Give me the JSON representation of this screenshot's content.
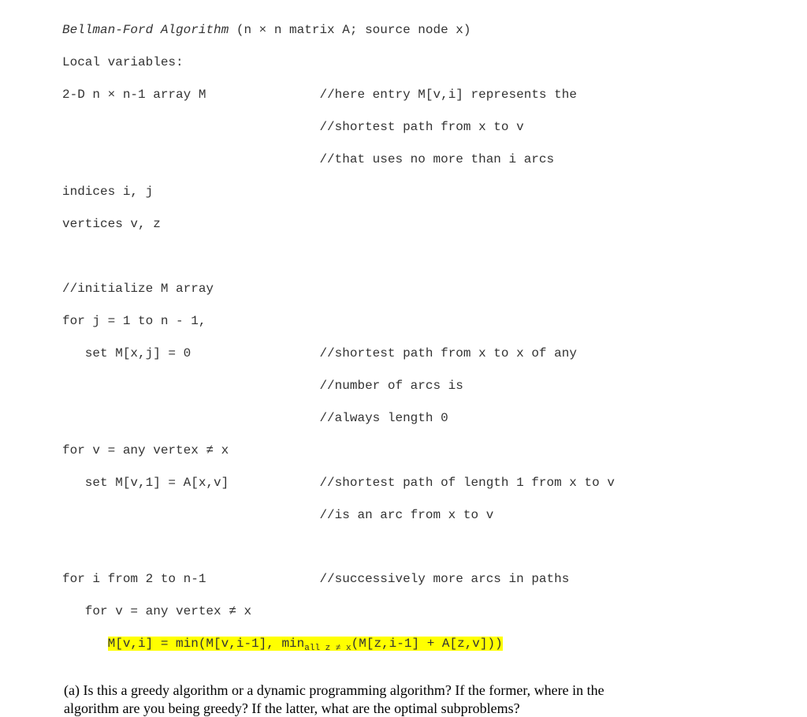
{
  "lines": {
    "title_italic": "Bellman-Ford Algorithm",
    "title_rest": " (n × n matrix A; source node x)",
    "local_vars": "Local variables:",
    "arr_decl_left": "2-D n × n-1 array M",
    "arr_decl_gap": "               ",
    "arr_comment1": "//here entry M[v,i] represents the",
    "arr_comment2_pad": "                                  ",
    "arr_comment2": "//shortest path from x to v",
    "arr_comment3_pad": "                                  ",
    "arr_comment3": "//that uses no more than i arcs",
    "indices": "indices i, j",
    "vertices": "vertices v, z",
    "init_comment": "//initialize M array",
    "for_j": "for j = 1 to n - 1,",
    "set_mxj": "   set M[x,j] = 0",
    "set_mxj_gap": "                 ",
    "mxj_comment1": "//shortest path from x to x of any",
    "mxj_comment2_pad": "                                  ",
    "mxj_comment2": "//number of arcs is",
    "mxj_comment3_pad": "                                  ",
    "mxj_comment3": "//always length 0",
    "for_v1": "for v = any vertex ≠ x",
    "set_mv1": "   set M[v,1] = A[x,v]",
    "set_mv1_gap": "            ",
    "mv1_comment1": "//shortest path of length 1 from x to v",
    "mv1_comment2_pad": "                                  ",
    "mv1_comment2": "//is an arc from x to v",
    "for_i": "for i from 2 to n-1",
    "for_i_gap": "               ",
    "for_i_comment": "//successively more arcs in paths",
    "for_v2": "   for v = any vertex ≠ x",
    "rec_pad": "      ",
    "rec_part1": "M[v,i] = min(M[v,i-1], min",
    "rec_sub": "all z ≠ x",
    "rec_part2": "(M[z,i-1] + A[z,v]))"
  },
  "question": {
    "label": "(a)",
    "text1": "  Is this a greedy algorithm or a dynamic programming algorithm?  If the former, where in the",
    "text2": "algorithm are you being greedy?  If the latter, what are the optimal subproblems?"
  }
}
